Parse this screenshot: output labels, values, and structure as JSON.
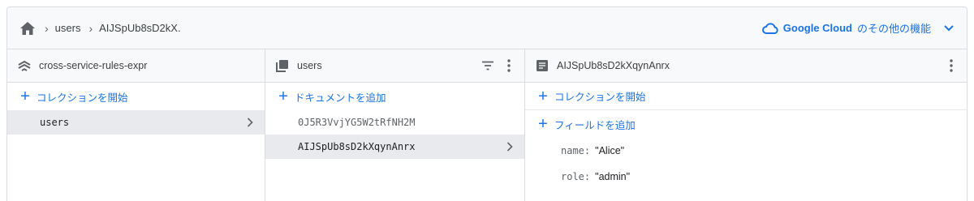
{
  "breadcrumb": {
    "items": [
      "users",
      "AIJSpUb8sD2kX."
    ]
  },
  "header_link": {
    "brand": "Google Cloud",
    "text": "のその他の機能"
  },
  "columns": {
    "project": {
      "title": "cross-service-rules-expr",
      "add_label": "コレクションを開始",
      "items": [
        "users"
      ]
    },
    "collection": {
      "title": "users",
      "add_label": "ドキュメントを追加",
      "items": [
        "0J5R3VvjYG5W2tRfNH2M",
        "AIJSpUb8sD2kXqynAnrx"
      ]
    },
    "document": {
      "title": "AIJSpUb8sD2kXqynAnrx",
      "add_collection_label": "コレクションを開始",
      "add_field_label": "フィールドを追加",
      "fields": [
        {
          "name": "name",
          "value": "\"Alice\""
        },
        {
          "name": "role",
          "value": "\"admin\""
        }
      ]
    }
  },
  "colors": {
    "accent": "#1a73e8",
    "selected_row": "#e8eaed",
    "header_bg": "#f8f9fa",
    "border": "#dadce0"
  },
  "icons": {
    "home": "home-icon",
    "project": "firestore-icon",
    "collection": "collection-icon",
    "document": "document-icon",
    "filter": "filter-icon",
    "more": "more-vert-icon",
    "cloud": "cloud-icon",
    "chevron": "chevron-down-icon",
    "arrow": "chevron-right-icon"
  }
}
